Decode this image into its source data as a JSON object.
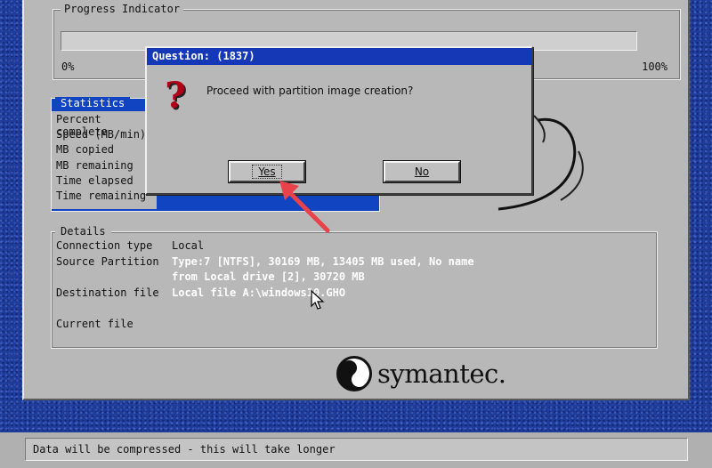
{
  "progress": {
    "title": "Progress Indicator",
    "min_label": "0%",
    "max_label": "100%",
    "value_percent": 0
  },
  "statistics": {
    "title": "Statistics",
    "rows": [
      "Percent complete",
      "Speed (MB/min)",
      "MB copied",
      "MB remaining",
      "Time elapsed",
      "Time remaining"
    ]
  },
  "details": {
    "title": "Details",
    "connection_type_label": "Connection type",
    "connection_type_value": "Local",
    "source_partition_label": "Source Partition",
    "source_partition_line1": "Type:7 [NTFS], 30169 MB, 13405 MB used, No name",
    "source_partition_line2": "from Local drive [2], 30720 MB",
    "destination_file_label": "Destination file",
    "destination_file_value": "Local file A:\\windows10.GHO",
    "current_file_label": "Current file"
  },
  "logo": {
    "text": "symantec."
  },
  "dialog": {
    "title": "Question: (1837)",
    "message": "Proceed with partition image creation?",
    "yes_label": "Yes",
    "no_label": "No"
  },
  "status": {
    "text": "Data will be compressed - this will take longer"
  },
  "colors": {
    "desktop": "#1e3c9a",
    "panel": "#b8b8b8",
    "title_bar": "#1539b6",
    "stats_highlight": "#1144c0",
    "annotation_arrow": "#e8424a"
  }
}
